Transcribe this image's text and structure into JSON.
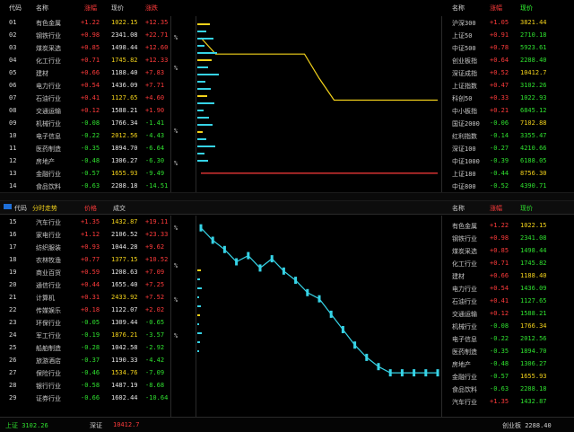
{
  "top_panel": {
    "header": {
      "col_code": "代码",
      "col_name": "名称",
      "col_change": "涨幅",
      "col_price": "现价",
      "col_rise": "涨跌",
      "right_col_a": "名称",
      "right_col_b": "涨幅",
      "right_col_c": "现价"
    },
    "axis_labels": [
      "%",
      "%",
      "%",
      "%"
    ],
    "left_rows": [
      {
        "code": "01",
        "name": "有色金属",
        "change": "+1.22",
        "price": "1022.15",
        "rise": "+12.35"
      },
      {
        "code": "02",
        "name": "钢铁行业",
        "change": "+0.98",
        "price": "2341.08",
        "rise": "+22.71"
      },
      {
        "code": "03",
        "name": "煤炭采选",
        "change": "+0.85",
        "price": "1498.44",
        "rise": "+12.60"
      },
      {
        "code": "04",
        "name": "化工行业",
        "change": "+0.71",
        "price": "1745.82",
        "rise": "+12.33"
      },
      {
        "code": "05",
        "name": "建材",
        "change": "+0.66",
        "price": "1188.40",
        "rise": "+7.83"
      },
      {
        "code": "06",
        "name": "电力行业",
        "change": "+0.54",
        "price": "1436.09",
        "rise": "+7.71"
      },
      {
        "code": "07",
        "name": "石油行业",
        "change": "+0.41",
        "price": "1127.65",
        "rise": "+4.60"
      },
      {
        "code": "08",
        "name": "交通运输",
        "change": "+0.12",
        "price": "1588.21",
        "rise": "+1.90"
      },
      {
        "code": "09",
        "name": "机械行业",
        "change": "-0.08",
        "price": "1766.34",
        "rise": "-1.41"
      },
      {
        "code": "10",
        "name": "电子信息",
        "change": "-0.22",
        "price": "2012.56",
        "rise": "-4.43"
      },
      {
        "code": "11",
        "name": "医药制造",
        "change": "-0.35",
        "price": "1894.70",
        "rise": "-6.64"
      },
      {
        "code": "12",
        "name": "房地产",
        "change": "-0.48",
        "price": "1306.27",
        "rise": "-6.30"
      },
      {
        "code": "13",
        "name": "金融行业",
        "change": "-0.57",
        "price": "1655.93",
        "rise": "-9.49"
      },
      {
        "code": "14",
        "name": "食品饮料",
        "change": "-0.63",
        "price": "2288.18",
        "rise": "-14.51"
      }
    ],
    "right_rows": [
      {
        "name": "沪深300",
        "change": "+1.05",
        "price": "3821.44"
      },
      {
        "name": "上证50",
        "change": "+0.91",
        "price": "2710.18"
      },
      {
        "name": "中证500",
        "change": "+0.78",
        "price": "5923.61"
      },
      {
        "name": "创业板指",
        "change": "+0.64",
        "price": "2288.40"
      },
      {
        "name": "深证成指",
        "change": "+0.52",
        "price": "10412.7"
      },
      {
        "name": "上证指数",
        "change": "+0.47",
        "price": "3102.26"
      },
      {
        "name": "科创50",
        "change": "+0.33",
        "price": "1022.93"
      },
      {
        "name": "中小板指",
        "change": "+0.21",
        "price": "6845.12"
      },
      {
        "name": "国证2000",
        "change": "-0.06",
        "price": "7102.88"
      },
      {
        "name": "红利指数",
        "change": "-0.14",
        "price": "3355.47"
      },
      {
        "name": "深证100",
        "change": "-0.27",
        "price": "4210.66"
      },
      {
        "name": "中证1000",
        "change": "-0.39",
        "price": "6188.05"
      },
      {
        "name": "上证180",
        "change": "-0.44",
        "price": "8756.30"
      },
      {
        "name": "中证800",
        "change": "-0.52",
        "price": "4390.71"
      }
    ]
  },
  "tab_bar": {
    "code_label": "代码",
    "title": "分时走势",
    "col_price": "价格",
    "col_vol": "成交",
    "right_a": "名称",
    "right_b": "涨幅",
    "right_c": "现价"
  },
  "bottom_panel": {
    "axis_labels": [
      "%",
      "%",
      "%",
      "%"
    ],
    "left_rows": [
      {
        "code": "15",
        "name": "汽车行业",
        "change": "+1.35",
        "price": "1432.87",
        "rise": "+19.11"
      },
      {
        "code": "16",
        "name": "家电行业",
        "change": "+1.12",
        "price": "2106.52",
        "rise": "+23.33"
      },
      {
        "code": "17",
        "name": "纺织服装",
        "change": "+0.93",
        "price": "1044.28",
        "rise": "+9.62"
      },
      {
        "code": "18",
        "name": "农林牧渔",
        "change": "+0.77",
        "price": "1377.15",
        "rise": "+10.52"
      },
      {
        "code": "19",
        "name": "商业百货",
        "change": "+0.59",
        "price": "1208.63",
        "rise": "+7.09"
      },
      {
        "code": "20",
        "name": "通信行业",
        "change": "+0.44",
        "price": "1655.40",
        "rise": "+7.25"
      },
      {
        "code": "21",
        "name": "计算机",
        "change": "+0.31",
        "price": "2433.92",
        "rise": "+7.52"
      },
      {
        "code": "22",
        "name": "传媒娱乐",
        "change": "+0.18",
        "price": "1122.07",
        "rise": "+2.02"
      },
      {
        "code": "23",
        "name": "环保行业",
        "change": "-0.05",
        "price": "1309.44",
        "rise": "-0.65"
      },
      {
        "code": "24",
        "name": "军工行业",
        "change": "-0.19",
        "price": "1876.21",
        "rise": "-3.57"
      },
      {
        "code": "25",
        "name": "船舶制造",
        "change": "-0.28",
        "price": "1042.58",
        "rise": "-2.92"
      },
      {
        "code": "26",
        "name": "旅游酒店",
        "change": "-0.37",
        "price": "1190.33",
        "rise": "-4.42"
      },
      {
        "code": "27",
        "name": "保险行业",
        "change": "-0.46",
        "price": "1534.76",
        "rise": "-7.09"
      },
      {
        "code": "28",
        "name": "银行行业",
        "change": "-0.58",
        "price": "1487.19",
        "rise": "-8.68"
      },
      {
        "code": "29",
        "name": "证券行业",
        "change": "-0.66",
        "price": "1602.44",
        "rise": "-10.64"
      }
    ],
    "right_rows": [
      {
        "name": "有色金属",
        "change": "+1.22",
        "price": "1022.15"
      },
      {
        "name": "钢铁行业",
        "change": "+0.98",
        "price": "2341.08"
      },
      {
        "name": "煤炭采选",
        "change": "+0.85",
        "price": "1498.44"
      },
      {
        "name": "化工行业",
        "change": "+0.71",
        "price": "1745.82"
      },
      {
        "name": "建材",
        "change": "+0.66",
        "price": "1188.40"
      },
      {
        "name": "电力行业",
        "change": "+0.54",
        "price": "1436.09"
      },
      {
        "name": "石油行业",
        "change": "+0.41",
        "price": "1127.65"
      },
      {
        "name": "交通运输",
        "change": "+0.12",
        "price": "1588.21"
      },
      {
        "name": "机械行业",
        "change": "-0.08",
        "price": "1766.34"
      },
      {
        "name": "电子信息",
        "change": "-0.22",
        "price": "2012.56"
      },
      {
        "name": "医药制造",
        "change": "-0.35",
        "price": "1894.70"
      },
      {
        "name": "房地产",
        "change": "-0.48",
        "price": "1306.27"
      },
      {
        "name": "金融行业",
        "change": "-0.57",
        "price": "1655.93"
      },
      {
        "name": "食品饮料",
        "change": "-0.63",
        "price": "2288.18"
      },
      {
        "name": "汽车行业",
        "change": "+1.35",
        "price": "1432.87"
      }
    ]
  },
  "status_bar": {
    "left_text": "上证 3102.26",
    "mid_a": "深证",
    "mid_b": "10412.7",
    "right_text": "创业板 2288.40"
  },
  "colors": {
    "up": "#ff3b3b",
    "down": "#2fe02f",
    "neutral": "#f3d21b",
    "line": "#36d3e6",
    "accent_blue": "#1e6fd9"
  },
  "chart_data": [
    {
      "type": "line",
      "series": [
        {
          "values": [
            3.2,
            2.6,
            2.6,
            2.6,
            2.6,
            2.6,
            2.6,
            2.6,
            1.7,
            0.9,
            0.9,
            0.9,
            0.9,
            0.9,
            0.9,
            0.9,
            0.9
          ]
        },
        {
          "values": [
            -1.8,
            -1.8,
            -1.8,
            -1.8,
            -1.8,
            -1.8,
            -1.8,
            -1.8,
            -1.8,
            -1.8,
            -1.8,
            -1.8,
            -1.8,
            -1.8,
            -1.8,
            -1.8,
            -1.8
          ]
        }
      ],
      "ylim": [
        -2.5,
        4
      ],
      "grid": false
    },
    {
      "type": "line",
      "series": [
        {
          "values": [
            3.6,
            3.2,
            2.9,
            2.5,
            2.7,
            2.3,
            2.6,
            2.2,
            1.9,
            1.5,
            1.3,
            0.8,
            0.3,
            -0.2,
            -0.6,
            -0.9,
            -1.1,
            -1.1,
            -1.1,
            -1.1,
            -1.1
          ]
        }
      ],
      "ylim": [
        -2,
        4
      ],
      "grid": false
    }
  ]
}
